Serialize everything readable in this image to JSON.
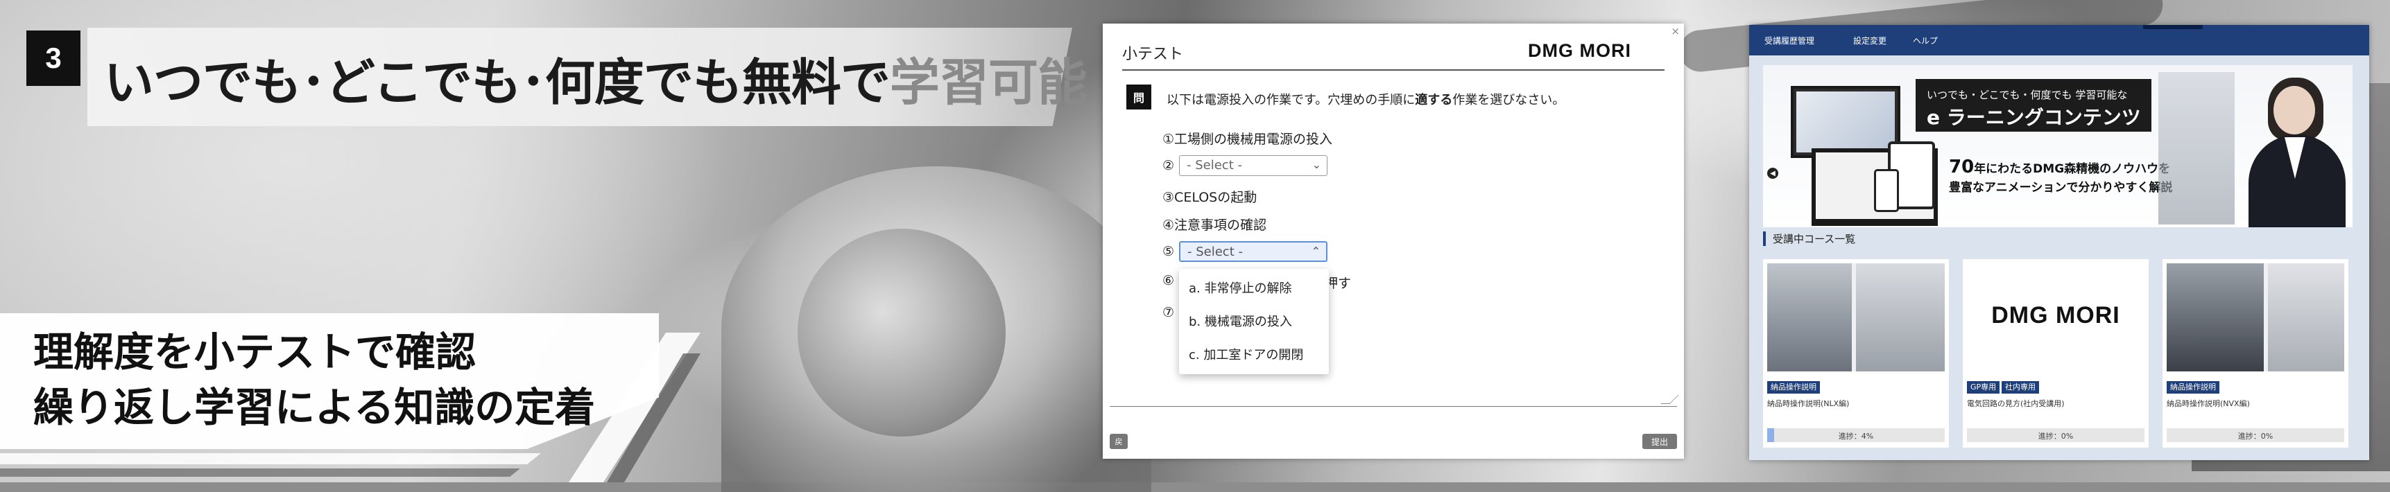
{
  "slide": {
    "number": "3",
    "headline_dark": "いつでも･どこでも･何度でも無料で",
    "headline_gray": "学習可能",
    "caption_line1": "理解度を小テストで確認",
    "caption_line2": "繰り返し学習による知識の定着"
  },
  "quiz": {
    "title": "小テスト",
    "brand": "DMG MORI",
    "close": "×",
    "question_mark": "問",
    "question_pre": "以下は電源投入の作業です。穴埋めの手順に",
    "question_bold": "適する",
    "question_post": "作業を選びなさい。",
    "steps": [
      {
        "num": "①",
        "text": "工場側の機械用電源の投入"
      },
      {
        "num": "②",
        "text": ""
      },
      {
        "num": "③",
        "text": "CELOSの起動"
      },
      {
        "num": "④",
        "text": "注意事項の確認"
      },
      {
        "num": "⑤",
        "text": ""
      },
      {
        "num": "⑥",
        "text": "押す"
      },
      {
        "num": "⑦",
        "text": ""
      }
    ],
    "select_placeholder": "- Select -",
    "options": [
      "a. 非常停止の解除",
      "b. 機械電源の投入",
      "c. 加工室ドアの開閉"
    ],
    "small_button": "戻",
    "submit_button": "提出"
  },
  "portal": {
    "nav": [
      "受講履歴管理",
      "設定変更",
      "ヘルプ"
    ],
    "hero": {
      "sub": "いつでも・どこでも・何度でも 学習可能な",
      "main": "e ラーニングコンテンツ",
      "desc_number": "70",
      "desc1": "年にわたるDMG森精機のノウハウを",
      "desc2": "豊富なアニメーションで分かりやすく解説"
    },
    "section_title": "受講中コース一覧",
    "cards": [
      {
        "tags": [
          "納品操作説明"
        ],
        "name": "納品時操作説明(NLX編)",
        "progress_label": "進捗：4%",
        "progress": 4,
        "logo": ""
      },
      {
        "tags": [
          "GP専用",
          "社内専用"
        ],
        "name": "電気回路の見方(社内受講用)",
        "progress_label": "進捗：0%",
        "progress": 0,
        "logo": "DMG MORI"
      },
      {
        "tags": [
          "納品操作説明"
        ],
        "name": "納品時操作説明(NVX編)",
        "progress_label": "進捗：0%",
        "progress": 0,
        "logo": ""
      }
    ]
  },
  "colors": {
    "nav_blue": "#1f3f7a",
    "select_focus": "#5b8fe0",
    "progress_fill": "#8fb0e6"
  }
}
